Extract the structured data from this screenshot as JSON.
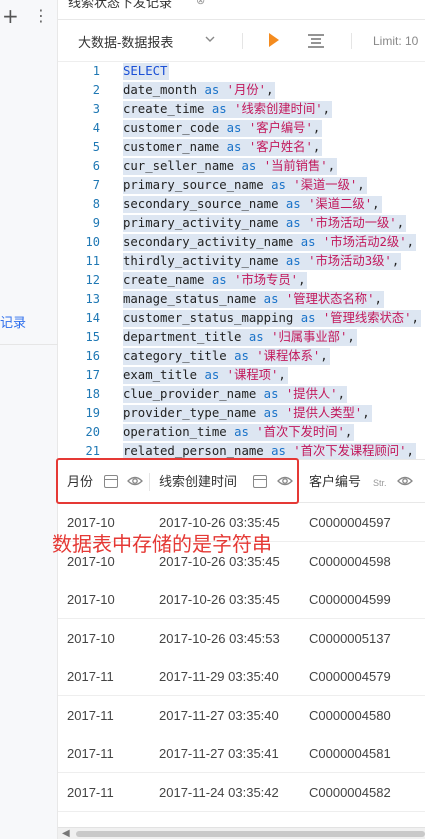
{
  "sidebar": {
    "plus_glyph": "+",
    "more_glyph": "⋮",
    "label": "记录"
  },
  "tab": {
    "title": "线索状态下发记录",
    "close_glyph": "⊗"
  },
  "toolbar": {
    "datasource": "大数据-数据报表",
    "limit_text": "Limit: 10"
  },
  "editor": {
    "lines": [
      {
        "num": "1",
        "keyword": "SELECT"
      },
      {
        "num": "2",
        "col": "date_month",
        "alias": "'月份'"
      },
      {
        "num": "3",
        "col": "create_time",
        "alias": "'线索创建时间'"
      },
      {
        "num": "4",
        "col": "customer_code",
        "alias": "'客户编号'"
      },
      {
        "num": "5",
        "col": "customer_name",
        "alias": "'客户姓名'"
      },
      {
        "num": "6",
        "col": "cur_seller_name",
        "alias": "'当前销售'"
      },
      {
        "num": "7",
        "col": "primary_source_name",
        "alias": "'渠道一级'"
      },
      {
        "num": "8",
        "col": "secondary_source_name",
        "alias": "'渠道二级'"
      },
      {
        "num": "9",
        "col": "primary_activity_name",
        "alias": "'市场活动一级'"
      },
      {
        "num": "10",
        "col": "secondary_activity_name",
        "alias": "'市场活动2级'"
      },
      {
        "num": "11",
        "col": "thirdly_activity_name",
        "alias": "'市场活动3级'"
      },
      {
        "num": "12",
        "col": "create_name",
        "alias": "'市场专员'"
      },
      {
        "num": "13",
        "col": "manage_status_name",
        "alias": "'管理状态名称'"
      },
      {
        "num": "14",
        "col": "customer_status_mapping",
        "alias": "'管理线索状态'"
      },
      {
        "num": "15",
        "col": "department_title",
        "alias": "'归属事业部'"
      },
      {
        "num": "16",
        "col": "category_title",
        "alias": "'课程体系'"
      },
      {
        "num": "17",
        "col": "exam_title",
        "alias": "'课程项'"
      },
      {
        "num": "18",
        "col": "clue_provider_name",
        "alias": "'提供人'"
      },
      {
        "num": "19",
        "col": "provider_type_name",
        "alias": "'提供人类型'"
      },
      {
        "num": "20",
        "col": "operation_time",
        "alias": "'首次下发时间'"
      },
      {
        "num": "21",
        "col": "related_person_name",
        "alias": "'首次下发课程顾问'"
      }
    ],
    "as_word": "as",
    "separator": ","
  },
  "results": {
    "columns": [
      {
        "label": "月份"
      },
      {
        "label": "线索创建时间"
      },
      {
        "label": "客户编号",
        "type_tag": "Str."
      }
    ],
    "rows": [
      [
        "2017-10",
        "2017-10-26 03:35:45",
        "C0000004597"
      ],
      [
        "2017-10",
        "2017-10-26 03:35:45",
        "C0000004598"
      ],
      [
        "2017-10",
        "2017-10-26 03:35:45",
        "C0000004599"
      ],
      [
        "2017-10",
        "2017-10-26 03:45:53",
        "C0000005137"
      ],
      [
        "2017-11",
        "2017-11-29 03:35:40",
        "C0000004579"
      ],
      [
        "2017-11",
        "2017-11-27 03:35:40",
        "C0000004580"
      ],
      [
        "2017-11",
        "2017-11-27 03:35:41",
        "C0000004581"
      ],
      [
        "2017-11",
        "2017-11-24 03:35:42",
        "C0000004582"
      ]
    ]
  },
  "annotation": {
    "text": "数据表中存储的是字符串",
    "color": "#e53935"
  },
  "colors": {
    "run": "#f48b1f",
    "keyword": "#1a4fd6",
    "string": "#c2185b",
    "line_number": "#1f78b4",
    "selection": "#dde6f2"
  }
}
